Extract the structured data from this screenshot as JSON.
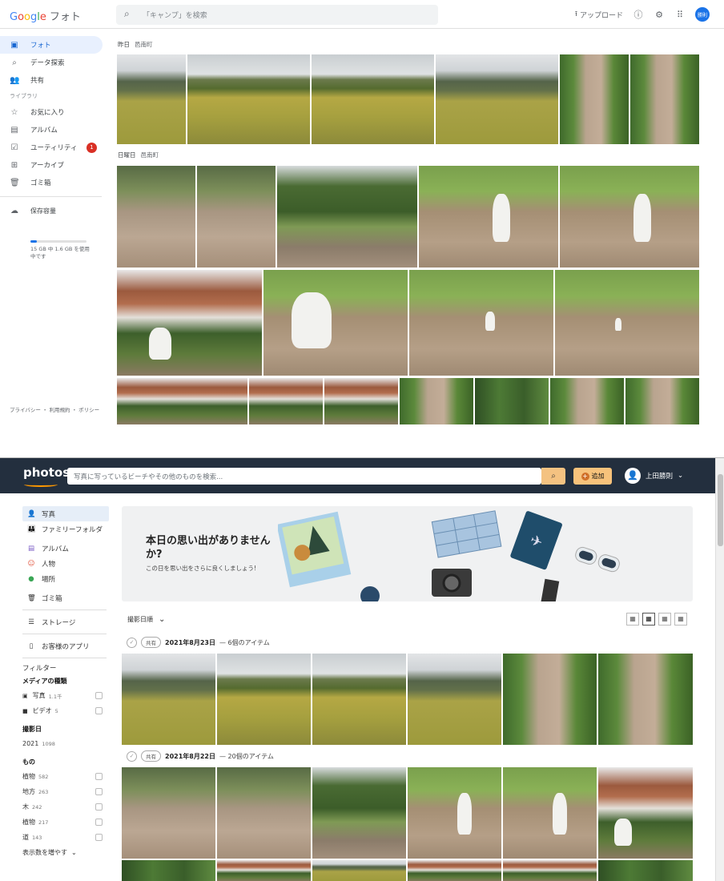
{
  "google": {
    "logo": "Google",
    "product": "フォト",
    "search_placeholder": "「キャンプ」を検索",
    "upload_label": "アップロード",
    "avatar_text": "勝則",
    "nav": [
      {
        "label": "フォト",
        "icon": "photo-icon"
      },
      {
        "label": "データ探索",
        "icon": "search-icon"
      },
      {
        "label": "共有",
        "icon": "people-icon"
      }
    ],
    "library_label": "ライブラリ",
    "library": [
      {
        "label": "お気に入り",
        "icon": "star-icon"
      },
      {
        "label": "アルバム",
        "icon": "album-icon"
      },
      {
        "label": "ユーティリティ",
        "icon": "utility-icon",
        "badge": "1"
      },
      {
        "label": "アーカイブ",
        "icon": "archive-icon"
      },
      {
        "label": "ゴミ箱",
        "icon": "trash-icon"
      }
    ],
    "storage_label": "保存容量",
    "storage_info": "15 GB 中 1.6 GB を使用中です",
    "storage_fraction": 0.11,
    "footer": "プライバシー ・ 利用規約 ・ ポリシー",
    "groups": [
      {
        "date": "昨日",
        "location": "邑南町"
      },
      {
        "date": "日曜日",
        "location": "邑南町"
      }
    ]
  },
  "amazon": {
    "logo": "photos",
    "search_placeholder": "写真に写っているビーチやその他のものを検索...",
    "add_label": "追加",
    "user_name": "上田勝則",
    "nav": [
      {
        "label": "写真",
        "icon": "person-icon"
      },
      {
        "label": "ファミリーフォルダ",
        "icon": "family-icon"
      },
      {
        "label": "アルバム",
        "icon": "album-icon"
      },
      {
        "label": "人物",
        "icon": "face-icon"
      },
      {
        "label": "場所",
        "icon": "location-icon"
      },
      {
        "label": "ゴミ箱",
        "icon": "trash-icon"
      },
      {
        "label": "ストレージ",
        "icon": "storage-icon"
      },
      {
        "label": "お客様のアプリ",
        "icon": "phone-icon"
      }
    ],
    "filter_label": "フィルター",
    "media_type_label": "メディアの種類",
    "media_types": [
      {
        "label": "写真",
        "count": "1.1千"
      },
      {
        "label": "ビデオ",
        "count": "5"
      }
    ],
    "shoot_date_label": "撮影日",
    "years": [
      {
        "label": "2021",
        "count": "1098"
      }
    ],
    "things_label": "もの",
    "things": [
      {
        "label": "植物",
        "count": "582"
      },
      {
        "label": "地方",
        "count": "263"
      },
      {
        "label": "木",
        "count": "242"
      },
      {
        "label": "植物",
        "count": "217"
      },
      {
        "label": "道",
        "count": "143"
      }
    ],
    "show_more": "表示数を増やす",
    "banner_title": "本日の思い出がありませんか?",
    "banner_sub": "この日を思い出をさらに良くしましょう!",
    "sort_label": "撮影日順",
    "shared_label": "共有",
    "groups": [
      {
        "date": "2021年8月23日",
        "items": "— 6個のアイテム"
      },
      {
        "date": "2021年8月22日",
        "items": "— 20個のアイテム"
      }
    ]
  }
}
